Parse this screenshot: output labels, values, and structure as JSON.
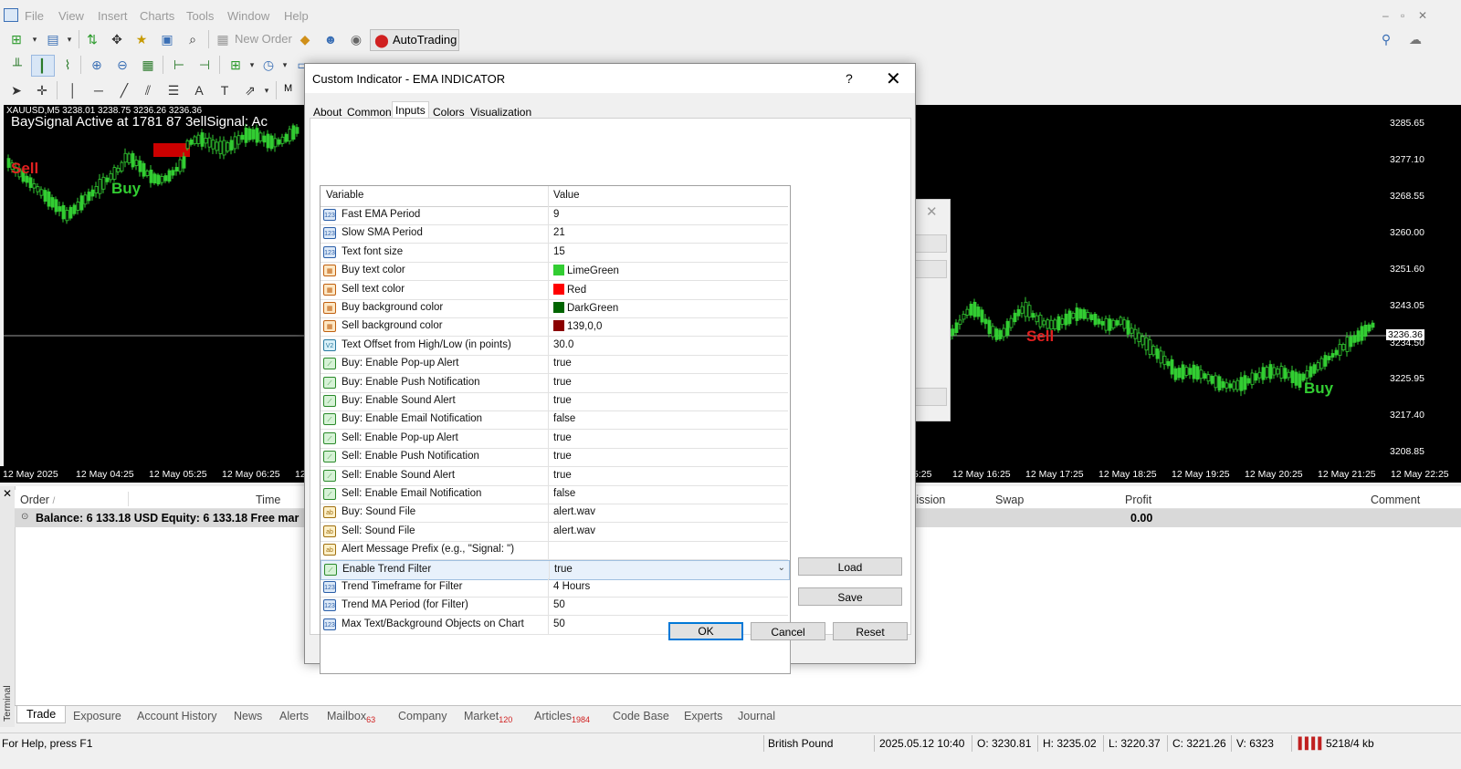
{
  "menu": {
    "items": [
      "File",
      "View",
      "Insert",
      "Charts",
      "Tools",
      "Window",
      "Help"
    ]
  },
  "toolbar": {
    "new_order": "New Order",
    "autotrading": "AutoTrading"
  },
  "chart": {
    "info_line": "XAUUSD,M5  3238.01 3238.75 3236.26 3236.36",
    "overlay_text": "BaySignal Active at 1781 87 3ellSignal: Ac",
    "sell_label": "Sell",
    "buy_label": "Buy",
    "price_labels": [
      "3285.65",
      "3277.10",
      "3268.55",
      "3260.00",
      "3251.60",
      "3243.05",
      "3236.36",
      "3234.50",
      "3225.95",
      "3217.40",
      "3208.85"
    ],
    "current_price": "3236.36",
    "time_labels_left": [
      "12 May 2025",
      "12 May 04:25",
      "12 May 05:25",
      "12 May 06:25",
      "12"
    ],
    "time_labels_right": [
      "5:25",
      "12 May 16:25",
      "12 May 17:25",
      "12 May 18:25",
      "12 May 19:25",
      "12 May 20:25",
      "12 May 21:25",
      "12 May 22:25"
    ]
  },
  "dialog": {
    "title": "Custom Indicator - EMA INDICATOR",
    "help": "?",
    "close": "✕",
    "tabs": [
      "About",
      "Common",
      "Inputs",
      "Colors",
      "Visualization"
    ],
    "active_tab": "Inputs",
    "grid_headers": {
      "variable": "Variable",
      "value": "Value"
    },
    "rows": [
      {
        "icon": "123",
        "var": "Fast EMA Period",
        "val": "9"
      },
      {
        "icon": "123",
        "var": "Slow SMA Period",
        "val": "21"
      },
      {
        "icon": "123",
        "var": "Text font size",
        "val": "15"
      },
      {
        "icon": "clr",
        "var": "Buy text color",
        "val": "LimeGreen",
        "swatch": "#32cd32"
      },
      {
        "icon": "clr",
        "var": "Sell text color",
        "val": "Red",
        "swatch": "#ff0000"
      },
      {
        "icon": "clr",
        "var": "Buy background color",
        "val": "DarkGreen",
        "swatch": "#006400"
      },
      {
        "icon": "clr",
        "var": "Sell background color",
        "val": "139,0,0",
        "swatch": "#8b0000"
      },
      {
        "icon": "V2",
        "var": "Text Offset from High/Low (in points)",
        "val": "30.0"
      },
      {
        "icon": "bool",
        "var": "Buy: Enable Pop-up Alert",
        "val": "true"
      },
      {
        "icon": "bool",
        "var": "Buy: Enable Push Notification",
        "val": "true"
      },
      {
        "icon": "bool",
        "var": "Buy: Enable Sound Alert",
        "val": "true"
      },
      {
        "icon": "bool",
        "var": "Buy: Enable Email Notification",
        "val": "false"
      },
      {
        "icon": "bool",
        "var": "Sell: Enable Pop-up Alert",
        "val": "true"
      },
      {
        "icon": "bool",
        "var": "Sell: Enable Push Notification",
        "val": "true"
      },
      {
        "icon": "bool",
        "var": "Sell: Enable Sound Alert",
        "val": "true"
      },
      {
        "icon": "bool",
        "var": "Sell: Enable Email Notification",
        "val": "false"
      },
      {
        "icon": "ab",
        "var": "Buy: Sound File",
        "val": "alert.wav"
      },
      {
        "icon": "ab",
        "var": "Sell: Sound File",
        "val": "alert.wav"
      },
      {
        "icon": "ab",
        "var": "Alert Message Prefix (e.g., \"Signal: \")",
        "val": ""
      },
      {
        "icon": "bool",
        "var": "Enable Trend Filter",
        "val": "true",
        "selected": true
      },
      {
        "icon": "123",
        "var": "Trend Timeframe for Filter",
        "val": "4 Hours"
      },
      {
        "icon": "123",
        "var": "Trend MA Period (for Filter)",
        "val": "50"
      },
      {
        "icon": "123",
        "var": "Max Text/Background Objects on Chart",
        "val": "50"
      }
    ],
    "buttons": {
      "load": "Load",
      "save": "Save",
      "ok": "OK",
      "cancel": "Cancel",
      "reset": "Reset"
    }
  },
  "terminal": {
    "label": "Terminal",
    "headers": {
      "order": "Order",
      "time": "Time",
      "commission": "mission",
      "swap": "Swap",
      "profit": "Profit",
      "comment": "Comment"
    },
    "balance_text": "Balance: 6 133.18 USD  Equity: 6 133.18  Free mar",
    "profit_total": "0.00",
    "tabs": [
      {
        "label": "Trade",
        "badge": ""
      },
      {
        "label": "Exposure",
        "badge": ""
      },
      {
        "label": "Account History",
        "badge": ""
      },
      {
        "label": "News",
        "badge": ""
      },
      {
        "label": "Alerts",
        "badge": ""
      },
      {
        "label": "Mailbox",
        "badge": "63"
      },
      {
        "label": "Company",
        "badge": ""
      },
      {
        "label": "Market",
        "badge": "120"
      },
      {
        "label": "Articles",
        "badge": "1984"
      },
      {
        "label": "Code Base",
        "badge": ""
      },
      {
        "label": "Experts",
        "badge": ""
      },
      {
        "label": "Journal",
        "badge": ""
      }
    ]
  },
  "statusbar": {
    "help": "For Help, press F1",
    "profile": "British Pound",
    "datetime": "2025.05.12 10:40",
    "open": "O: 3230.81",
    "high": "H: 3235.02",
    "low": "L: 3220.37",
    "close": "C: 3221.26",
    "volume": "V: 6323",
    "traffic": "5218/4 kb"
  },
  "colors": {
    "bull": "#32cd32",
    "bear": "#32cd32",
    "sell_text": "#e02020",
    "buy_text": "#32cd32",
    "accent": "#0078d7"
  }
}
